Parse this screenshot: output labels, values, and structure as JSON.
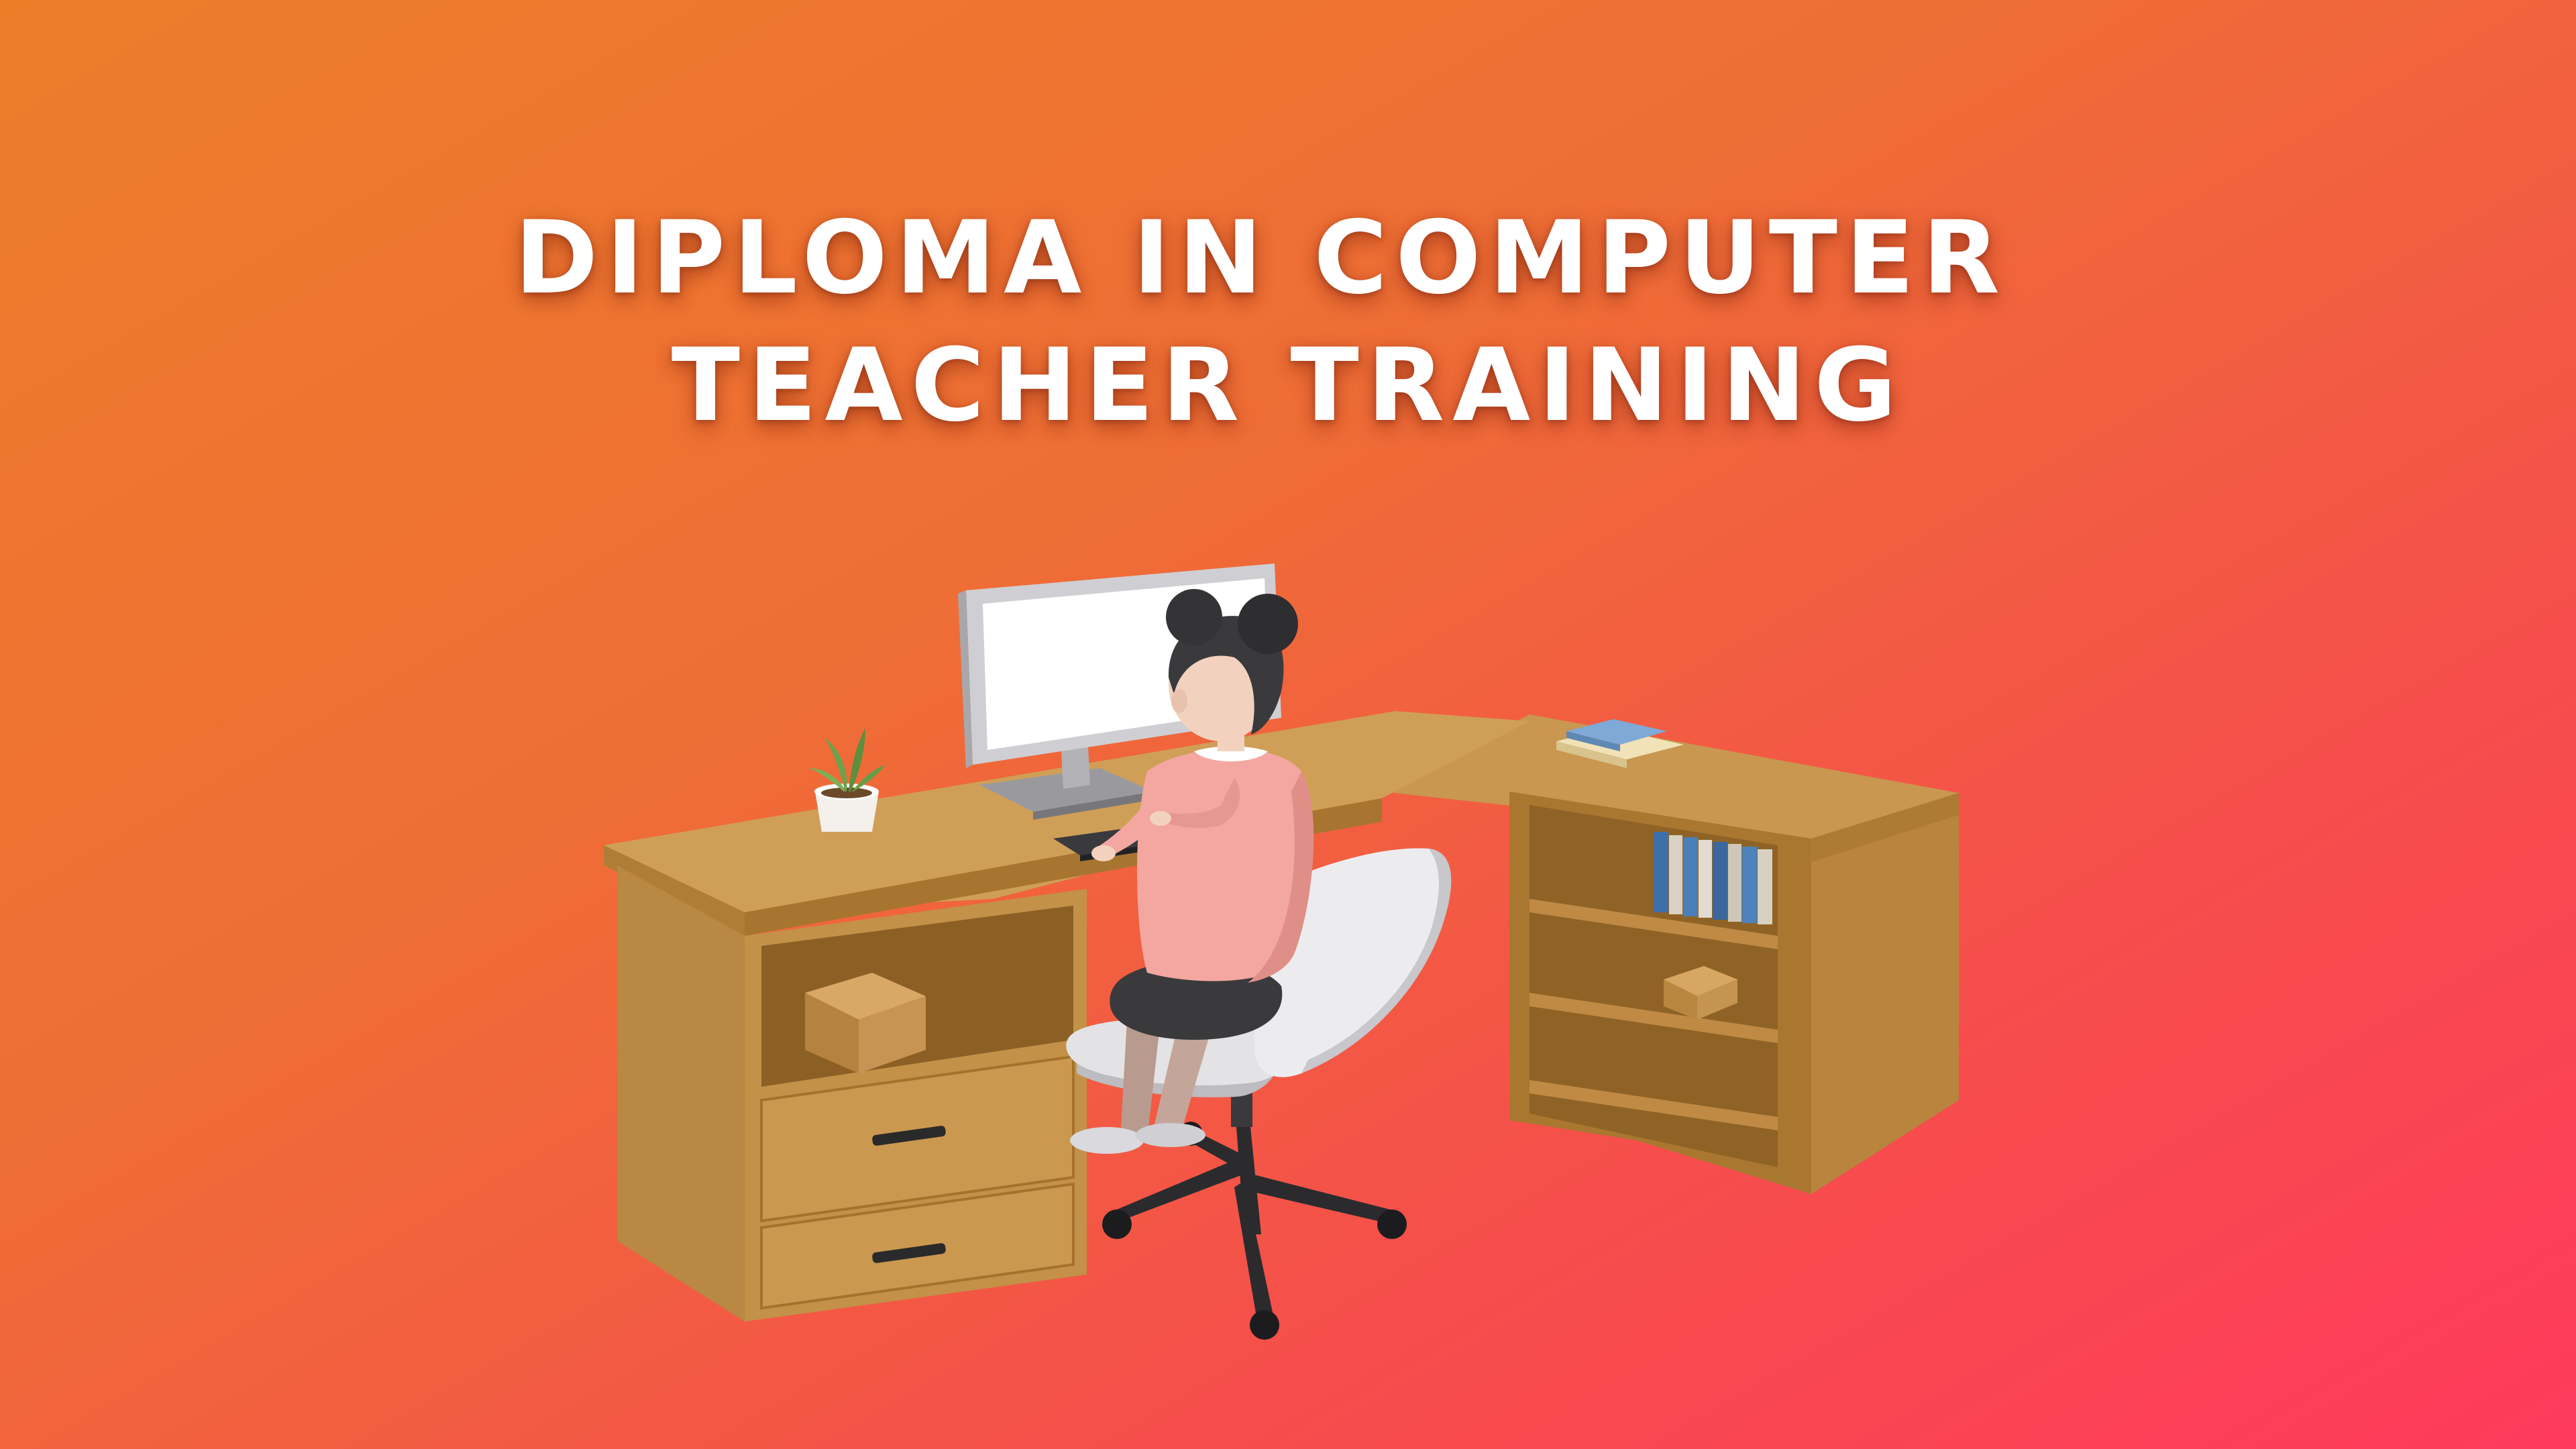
{
  "banner": {
    "title_line_1": "DIPLOMA IN COMPUTER",
    "title_line_2": "TEACHER TRAINING"
  },
  "colors": {
    "gradient_start": "#ee7d2a",
    "gradient_end": "#ff3a5c",
    "title_text": "#ffffff",
    "desk_wood": "#c8974e",
    "shirt": "#f4a6a0",
    "chair": "#e8e8ea"
  },
  "illustration": {
    "subject": "woman-at-computer-desk",
    "icons": [
      "monitor-icon",
      "keyboard-icon",
      "plant-icon",
      "books-icon",
      "office-chair-icon"
    ]
  }
}
